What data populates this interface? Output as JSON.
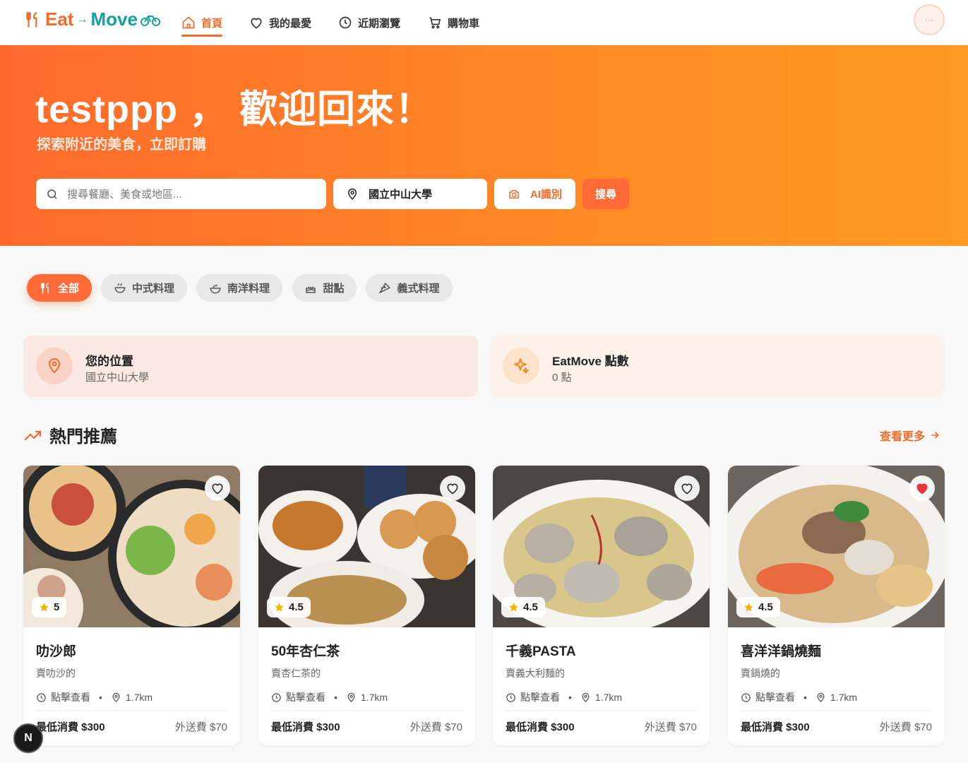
{
  "nav": {
    "logo": {
      "eat": "Eat",
      "arrow": "→",
      "move": "Move"
    },
    "items": [
      {
        "label": "首頁",
        "icon": "home-icon"
      },
      {
        "label": "我的最愛",
        "icon": "heart-icon"
      },
      {
        "label": "近期瀏覽",
        "icon": "clock-icon"
      },
      {
        "label": "購物車",
        "icon": "cart-icon"
      }
    ],
    "avatar_text": "···"
  },
  "hero": {
    "title": "testppp ， 歡迎回來！",
    "subtitle": "探索附近的美食，立即訂購",
    "search_placeholder": "搜尋餐廳、美食或地區...",
    "location": "國立中山大學",
    "ai_label": "AI識別",
    "search_label": "搜尋"
  },
  "categories": [
    {
      "label": "全部",
      "icon": "utensils-icon",
      "active": true
    },
    {
      "label": "中式料理",
      "icon": "bowl-icon",
      "active": false
    },
    {
      "label": "南洋料理",
      "icon": "salad-icon",
      "active": false
    },
    {
      "label": "甜點",
      "icon": "cake-icon",
      "active": false
    },
    {
      "label": "義式料理",
      "icon": "pizza-icon",
      "active": false
    }
  ],
  "info": {
    "location_title": "您的位置",
    "location_value": "國立中山大學",
    "points_title": "EatMove 點數",
    "points_value": "0 點"
  },
  "section": {
    "title": "熱門推薦",
    "see_more": "查看更多"
  },
  "restaurants": [
    {
      "name": "叻沙郎",
      "desc": "賣叻沙的",
      "rating": "5",
      "hours": "點擊查看",
      "distance": "1.7km",
      "min_order": "最低消費 $300",
      "delivery_fee": "外送費 $70",
      "favorited": false
    },
    {
      "name": "50年杏仁茶",
      "desc": "賣杏仁茶的",
      "rating": "4.5",
      "hours": "點擊查看",
      "distance": "1.7km",
      "min_order": "最低消費 $300",
      "delivery_fee": "外送費 $70",
      "favorited": false
    },
    {
      "name": "千義PASTA",
      "desc": "賣義大利麵的",
      "rating": "4.5",
      "hours": "點擊查看",
      "distance": "1.7km",
      "min_order": "最低消費 $300",
      "delivery_fee": "外送費 $70",
      "favorited": false
    },
    {
      "name": "喜洋洋鍋燒麵",
      "desc": "賣鍋燒的",
      "rating": "4.5",
      "hours": "點擊查看",
      "distance": "1.7km",
      "min_order": "最低消費 $300",
      "delivery_fee": "外送費 $70",
      "favorited": true
    }
  ],
  "colors": {
    "brand": "#f26b2a",
    "accent": "#14a39a",
    "fav_active": "#e5393f"
  },
  "badge_letter": "N"
}
